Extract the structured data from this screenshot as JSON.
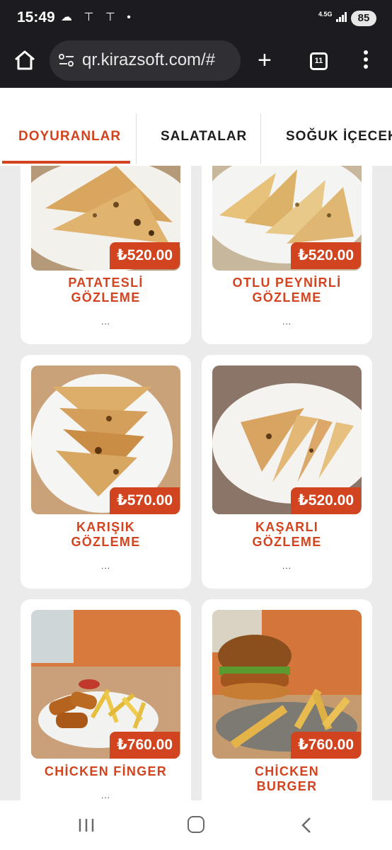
{
  "status_bar": {
    "time": "15:49",
    "left_icons": [
      "cloud-icon",
      "tesla-icon",
      "tesla-icon",
      "dot-icon"
    ],
    "left_icons_glyph": "☁ ⊤ ⊤ •",
    "network": "4.5G",
    "battery": "85"
  },
  "browser": {
    "url": "qr.kirazsoft.com/#",
    "tab_count": "11"
  },
  "categories": [
    {
      "label": "DOYURANLAR",
      "active": true
    },
    {
      "label": "SALATALAR",
      "active": false
    },
    {
      "label": "SOĞUK İÇECEKL",
      "active": false
    }
  ],
  "products": [
    {
      "name_line1": "PATATESLİ",
      "name_line2": "GÖZLEME",
      "price": "₺520.00",
      "desc": "...",
      "image": "gozleme"
    },
    {
      "name_line1": "OTLU PEYNİRLİ",
      "name_line2": "GÖZLEME",
      "price": "₺520.00",
      "desc": "...",
      "image": "gozleme"
    },
    {
      "name_line1": "KARIŞIK",
      "name_line2": "GÖZLEME",
      "price": "₺570.00",
      "desc": "...",
      "image": "gozleme"
    },
    {
      "name_line1": "KAŞARLI",
      "name_line2": "GÖZLEME",
      "price": "₺520.00",
      "desc": "...",
      "image": "gozleme"
    },
    {
      "name_line1": "CHİCKEN FİNGER",
      "name_line2": "",
      "price": "₺760.00",
      "desc": "...",
      "image": "chicken-finger"
    },
    {
      "name_line1": "CHİCKEN",
      "name_line2": "BURGER",
      "price": "₺760.00",
      "desc": "",
      "image": "burger"
    }
  ],
  "colors": {
    "accent": "#d2441f",
    "page_background": "#ebebeb",
    "browser_chrome": "#1c1b1f"
  }
}
